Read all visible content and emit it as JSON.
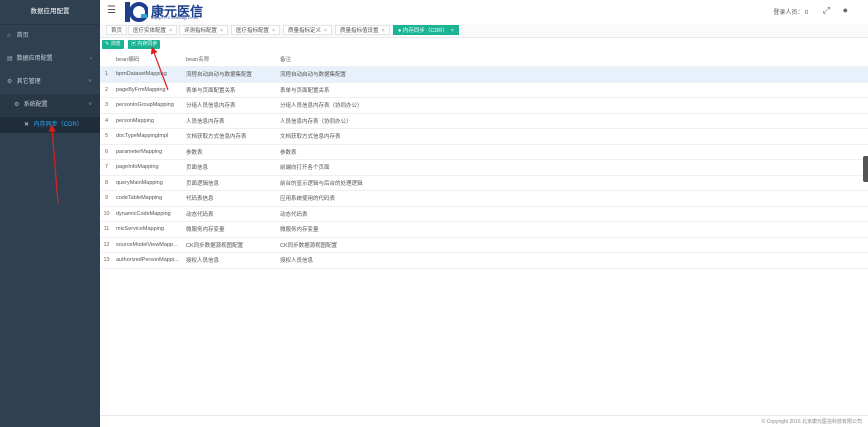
{
  "sidebar": {
    "title": "数据应用配置",
    "items": [
      {
        "label": "首页",
        "icon": "home-icon"
      },
      {
        "label": "数据应用配置",
        "icon": "database-icon"
      },
      {
        "label": "其它管理",
        "icon": "settings-icon"
      }
    ],
    "sub": {
      "label": "系统配置",
      "icon": "gear-icon"
    },
    "leaf": {
      "label": "内存同步（CDR）",
      "icon": "tools-icon"
    }
  },
  "header": {
    "logo_text": "康元医信",
    "logo_sub": "Beijing KYYX Technology Co.,Ltd",
    "user_label": "登录人员：",
    "user_name": "it"
  },
  "tabs": [
    {
      "label": "首页"
    },
    {
      "label": "医疗实体配置"
    },
    {
      "label": "评测指标配置"
    },
    {
      "label": "医疗指标配置"
    },
    {
      "label": "质量指标定义"
    },
    {
      "label": "质量指标值设置"
    },
    {
      "label": "内存同步（CDR）",
      "active": true
    }
  ],
  "toolbar": {
    "browse_label": "浏览",
    "sync_label": "内存同步"
  },
  "table": {
    "headers": [
      "",
      "bean编码",
      "bean名称",
      "备注"
    ],
    "rows": [
      [
        "1",
        "bpmDatasetMapping",
        "流程自动启动与数据集配置",
        "流程自动启动与数据集配置"
      ],
      [
        "2",
        "pageByFrmMapping",
        "表单与页面配置关系",
        "表单与页面配置关系"
      ],
      [
        "3",
        "personInGroupMapping",
        "分组人员信息内存表",
        "分组人员信息内存表（协同办公）"
      ],
      [
        "4",
        "personMapping",
        "人员信息内存表",
        "人员信息内存表（协同办公）"
      ],
      [
        "5",
        "docTypeMappingImpl",
        "文档获取方式信息内存表",
        "文档获取方式信息内存表"
      ],
      [
        "6",
        "parameterMapping",
        "参数表",
        "参数表"
      ],
      [
        "7",
        "pageInfoMapping",
        "页面信息",
        "前端向打开各个页面"
      ],
      [
        "8",
        "queryMainMapping",
        "页面逻辑信息",
        "前台的显示逻辑与后台的处理逻辑"
      ],
      [
        "9",
        "codeTableMapping",
        "代码表信息",
        "应用系统使用的代码表"
      ],
      [
        "10",
        "dynamicCodeMapping",
        "动态代码表",
        "动态代码表"
      ],
      [
        "11",
        "micServiceMapping",
        "微服务内存变量",
        "微服务内存变量"
      ],
      [
        "12",
        "sourceModelViewMapp...",
        "CK同步数据源视图配置",
        "CK同步数据源视图配置"
      ],
      [
        "13",
        "authorizedPersonMappi...",
        "授权人员信息",
        "授权人员信息"
      ]
    ]
  },
  "footer": {
    "copyright": "© Copyright 2016 北京康元医信科技有限公司"
  },
  "colors": {
    "sidebar_bg": "#2f4050",
    "accent": "#1ab394",
    "annotation": "#e02020"
  }
}
